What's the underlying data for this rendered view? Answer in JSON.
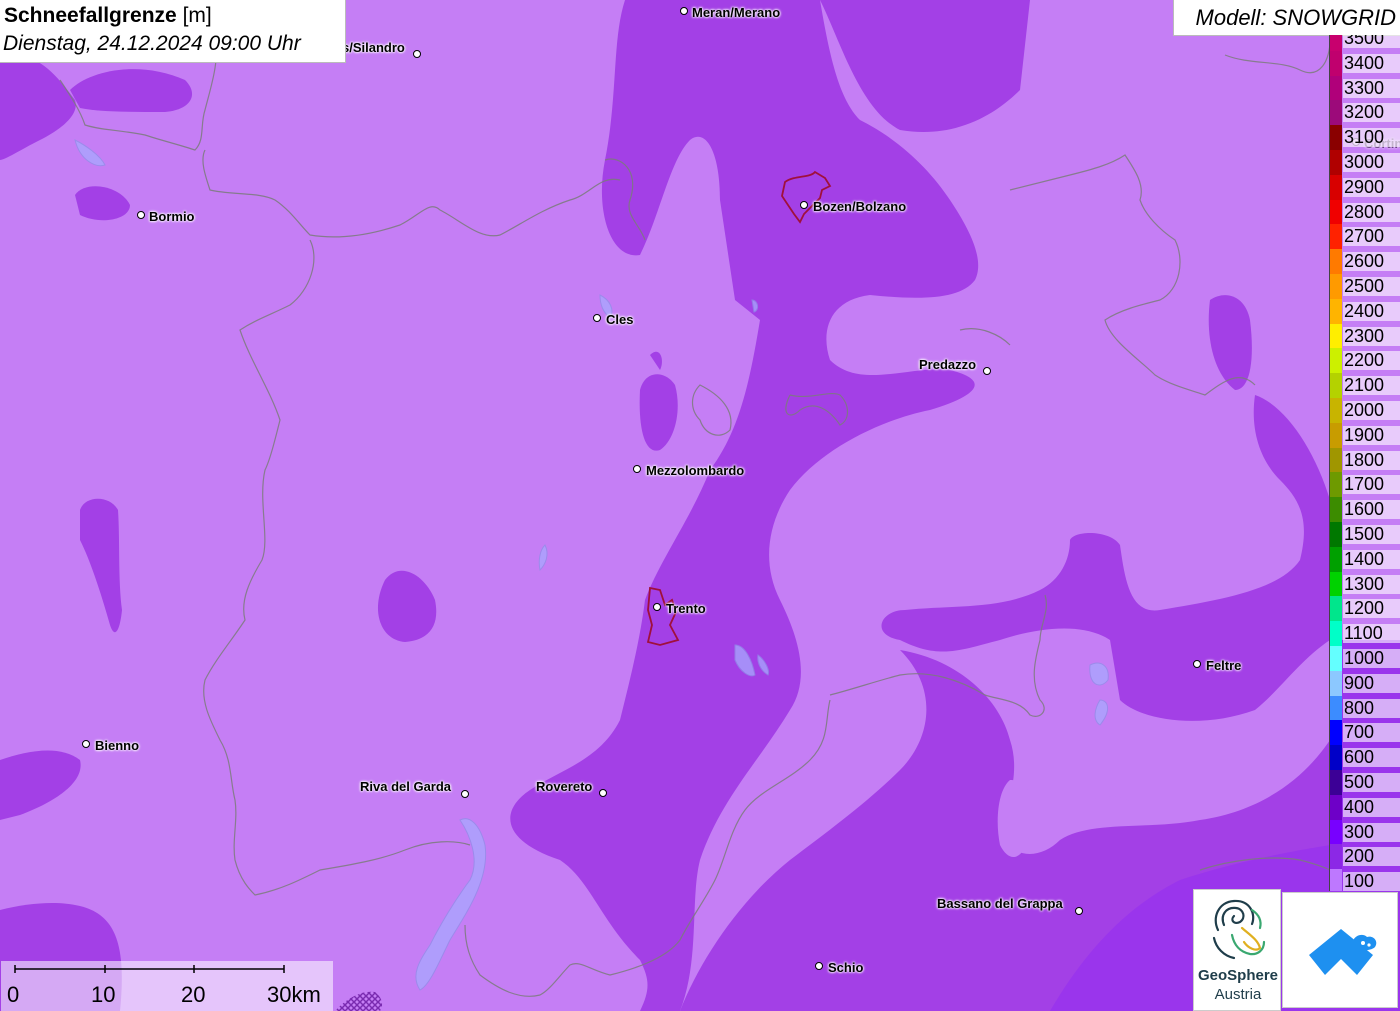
{
  "title": {
    "parameter": "Schneefallgrenze",
    "unit": "[m]",
    "datetime": "Dienstag, 24.12.2024 09:00 Uhr"
  },
  "model": "Modell: SNOWGRID",
  "legend": [
    {
      "label": "3500",
      "color": "#c8006e"
    },
    {
      "label": "3400",
      "color": "#c0006e"
    },
    {
      "label": "3300",
      "color": "#b0007a"
    },
    {
      "label": "3200",
      "color": "#9c0a7a"
    },
    {
      "label": "3100",
      "color": "#8a0000"
    },
    {
      "label": "3000",
      "color": "#b00000"
    },
    {
      "label": "2900",
      "color": "#d80000"
    },
    {
      "label": "2800",
      "color": "#f00000"
    },
    {
      "label": "2700",
      "color": "#ff2200"
    },
    {
      "label": "2600",
      "color": "#ff7a00"
    },
    {
      "label": "2500",
      "color": "#ff9a00"
    },
    {
      "label": "2400",
      "color": "#ffb400"
    },
    {
      "label": "2300",
      "color": "#ffee00"
    },
    {
      "label": "2200",
      "color": "#ccf000"
    },
    {
      "label": "2100",
      "color": "#b4d200"
    },
    {
      "label": "2000",
      "color": "#c8b400"
    },
    {
      "label": "1900",
      "color": "#c89c00"
    },
    {
      "label": "1800",
      "color": "#a09600"
    },
    {
      "label": "1700",
      "color": "#6e9a00"
    },
    {
      "label": "1600",
      "color": "#3c8c00"
    },
    {
      "label": "1500",
      "color": "#007800"
    },
    {
      "label": "1400",
      "color": "#00a000"
    },
    {
      "label": "1300",
      "color": "#00d200"
    },
    {
      "label": "1200",
      "color": "#00e68c"
    },
    {
      "label": "1100",
      "color": "#00ffc8"
    },
    {
      "label": "1000",
      "color": "#64ffff"
    },
    {
      "label": "900",
      "color": "#8cc8ff"
    },
    {
      "label": "800",
      "color": "#3c8cff"
    },
    {
      "label": "700",
      "color": "#0000ff"
    },
    {
      "label": "600",
      "color": "#0000c8"
    },
    {
      "label": "500",
      "color": "#3c0096"
    },
    {
      "label": "400",
      "color": "#6e00c8"
    },
    {
      "label": "300",
      "color": "#7800ff"
    },
    {
      "label": "200",
      "color": "#8c28e6"
    },
    {
      "label": "100",
      "color": "#be78ff"
    }
  ],
  "cities": [
    {
      "name": "Meran/Merano"
    },
    {
      "name": "s/Silandro"
    },
    {
      "name": "Bormio"
    },
    {
      "name": "Bozen/Bolzano"
    },
    {
      "name": "Cles"
    },
    {
      "name": "Predazzo"
    },
    {
      "name": "Cortina"
    },
    {
      "name": "Mezzolombardo"
    },
    {
      "name": "Trento"
    },
    {
      "name": "Feltre"
    },
    {
      "name": "Bienno"
    },
    {
      "name": "Riva del Garda"
    },
    {
      "name": "Rovereto"
    },
    {
      "name": "Bassano del Grappa"
    },
    {
      "name": "Schio"
    }
  ],
  "scale_bar": {
    "labels": [
      "0",
      "10",
      "20",
      "30km"
    ]
  },
  "logos": {
    "geosphere_line1": "GeoSphere",
    "geosphere_line2": "Austria"
  },
  "colors": {
    "base_fill": "#c57ef5",
    "dark_fill": "#a340e6",
    "deep_fill": "#9a35ec",
    "border_line": "#777777",
    "lake_fill": "#a8a8ff"
  }
}
